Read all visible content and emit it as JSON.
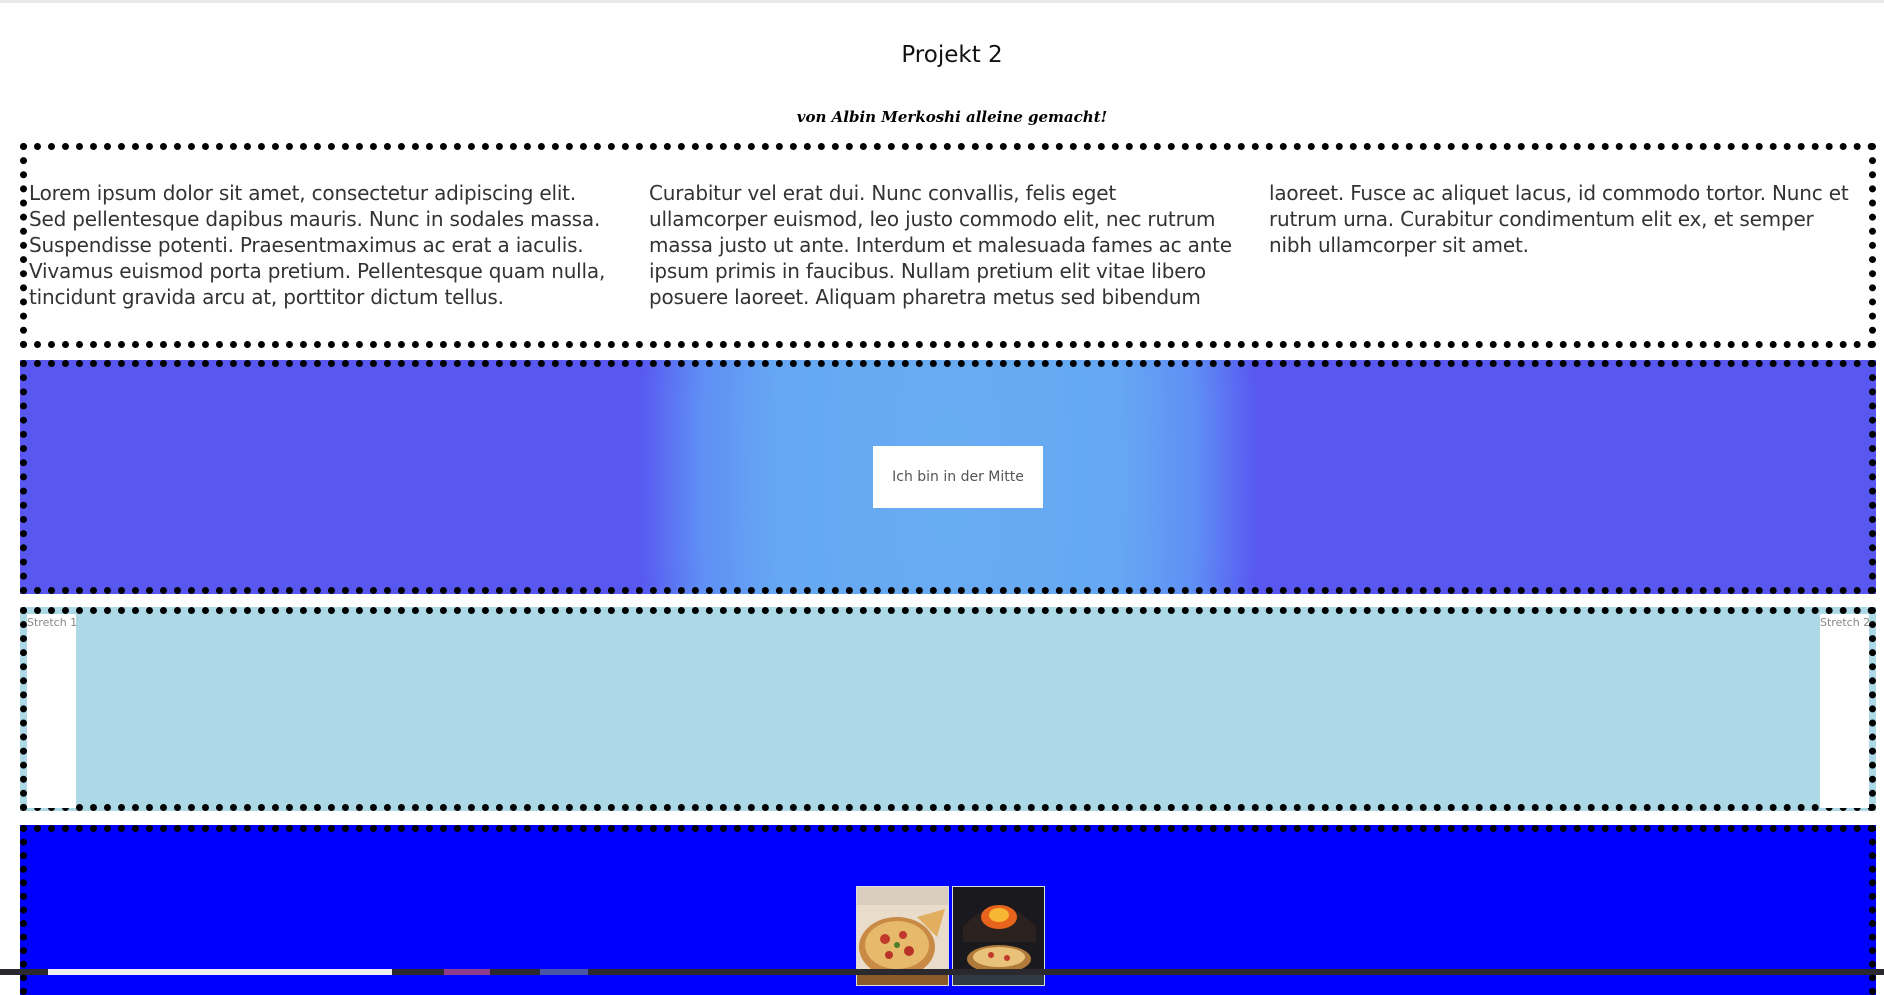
{
  "header": {
    "title": "Projekt 2",
    "subtitle": "von Albin Merkoshi alleine gemacht!"
  },
  "section_text": {
    "columns": [
      "Lorem ipsum dolor sit amet, consectetur adipiscing elit. Sed pellentesque dapibus mauris. Nunc in sodales massa. Suspendisse potenti. Praesentmaximus ac erat a iaculis. Vivamus euismod porta pretium. Pellentesque quam nulla, tincidunt gravida arcu at, porttitor dictum tellus.",
      "Curabitur vel erat dui. Nunc convallis, felis eget ullamcorper euismod, leo justo commodo elit, nec rutrum massa justo ut ante. Interdum et malesuada fames ac ante ipsum primis in faucibus. Nullam pretium elit vitae libero posuere laoreet. Aliquam pharetra metus sed bibendum",
      "laoreet. Fusce ac aliquet lacus, id commodo tortor. Nunc et rutrum urna. Curabitur condimentum elit ex, et semper nibh ullamcorper sit amet."
    ]
  },
  "section_center": {
    "box_text": "Ich bin in der Mitte",
    "gradient_colors": [
      "#68acf2",
      "#5858f1"
    ]
  },
  "section_stretch": {
    "left_label": "Stretch 1",
    "right_label": "Stretch 2",
    "background": "#add8e6"
  },
  "section_images": {
    "background": "#0000ff",
    "images": [
      "pizza-slice-image",
      "pizza-oven-image"
    ]
  }
}
